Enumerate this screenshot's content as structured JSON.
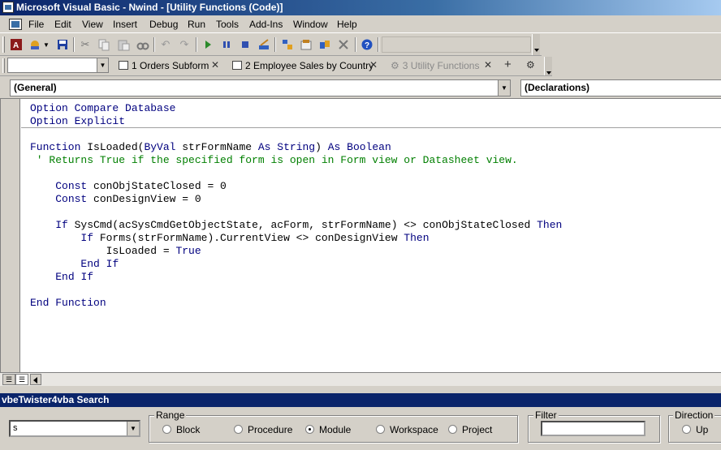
{
  "window": {
    "title": "Microsoft Visual Basic - Nwind - [Utility Functions (Code)]"
  },
  "menu": [
    "File",
    "Edit",
    "View",
    "Insert",
    "Debug",
    "Run",
    "Tools",
    "Add-Ins",
    "Window",
    "Help"
  ],
  "toolbar": {
    "icons": [
      "access-icon",
      "insert-userform-icon",
      "save-icon",
      "cut-icon",
      "copy-icon",
      "paste-icon",
      "find-icon",
      "undo-icon",
      "redo-icon",
      "run-icon",
      "break-icon",
      "reset-icon",
      "design-mode-icon",
      "project-explorer-icon",
      "properties-icon",
      "object-browser-icon",
      "toolbox-icon",
      "help-icon"
    ]
  },
  "tabs": [
    {
      "label": "1 Orders Subform",
      "active": true
    },
    {
      "label": "2 Employee Sales by Country",
      "active": true
    },
    {
      "label": "3 Utility Functions",
      "active": false
    }
  ],
  "tabs_add": "+",
  "code_window": {
    "object_combo": "(General)",
    "procedure_combo": "(Declarations)",
    "lines": [
      "Option Compare Database",
      "Option Explicit",
      "",
      "Function IsLoaded(ByVal strFormName As String) As Boolean",
      " ' Returns True if the specified form is open in Form view or Datasheet view.",
      "",
      "    Const conObjStateClosed = 0",
      "    Const conDesignView = 0",
      "",
      "    If SysCmd(acSysCmdGetObjectState, acForm, strFormName) <> conObjStateClosed Then",
      "        If Forms(strFormName).CurrentView <> conDesignView Then",
      "            IsLoaded = True",
      "        End If",
      "    End If",
      "",
      "End Function"
    ]
  },
  "search": {
    "title": "vbeTwister4vba Search",
    "query": "s",
    "range_label": "Range",
    "range_options": [
      "Block",
      "Procedure",
      "Module",
      "Workspace",
      "Project"
    ],
    "range_selected": "Module",
    "filter_label": "Filter",
    "filter_value": "",
    "direction_label": "Direction",
    "direction_options": [
      "Up"
    ]
  },
  "colors": {
    "title_bar": "#0a246a",
    "keyword": "#00007f",
    "comment": "#007f00",
    "face": "#d4d0c8"
  }
}
